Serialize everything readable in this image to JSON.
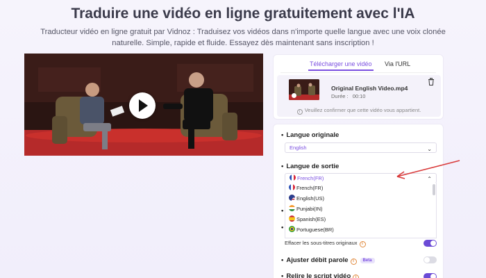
{
  "page": {
    "title": "Traduire une vidéo en ligne gratuitement avec l'IA",
    "subtitle": "Traducteur vidéo en ligne gratuit par Vidnoz : Traduisez vos vidéos dans n'importe quelle langue avec une voix clonée naturelle. Simple, rapide et fluide. Essayez dès maintenant sans inscription !"
  },
  "video": {
    "play_icon": "play-icon"
  },
  "upload": {
    "tab_upload": "Télécharger une vidéo",
    "tab_url": "Via l'URL",
    "file_name": "Original English Video.mp4",
    "duration_label": "Durée :",
    "duration_value": "00:10",
    "confirm_text": "Veuillez confirmer que cette vidéo vous appartient."
  },
  "settings": {
    "original_language_label": "Langue originale",
    "original_language_value": "English",
    "output_language_label": "Langue de sortie",
    "output_language_value": "French(FR)",
    "options": [
      {
        "label": "French(FR)",
        "flag": "fr"
      },
      {
        "label": "English(US)",
        "flag": "us"
      },
      {
        "label": "Punjabi(IN)",
        "flag": "in"
      },
      {
        "label": "Spanish(ES)",
        "flag": "es"
      },
      {
        "label": "Portuguese(BR)",
        "flag": "br"
      }
    ],
    "erase_subtitles_label": "Effacer les sous-titres originaux",
    "erase_subtitles_on": true,
    "adjust_speed_label": "Ajuster débit parole",
    "adjust_speed_badge": "Beta",
    "adjust_speed_on": false,
    "review_script_label": "Relire le script vidéo",
    "review_script_on": true
  },
  "colors": {
    "accent": "#7a4ee0",
    "toggle_on": "#6b4bd6",
    "arrow": "#d93a3a"
  }
}
